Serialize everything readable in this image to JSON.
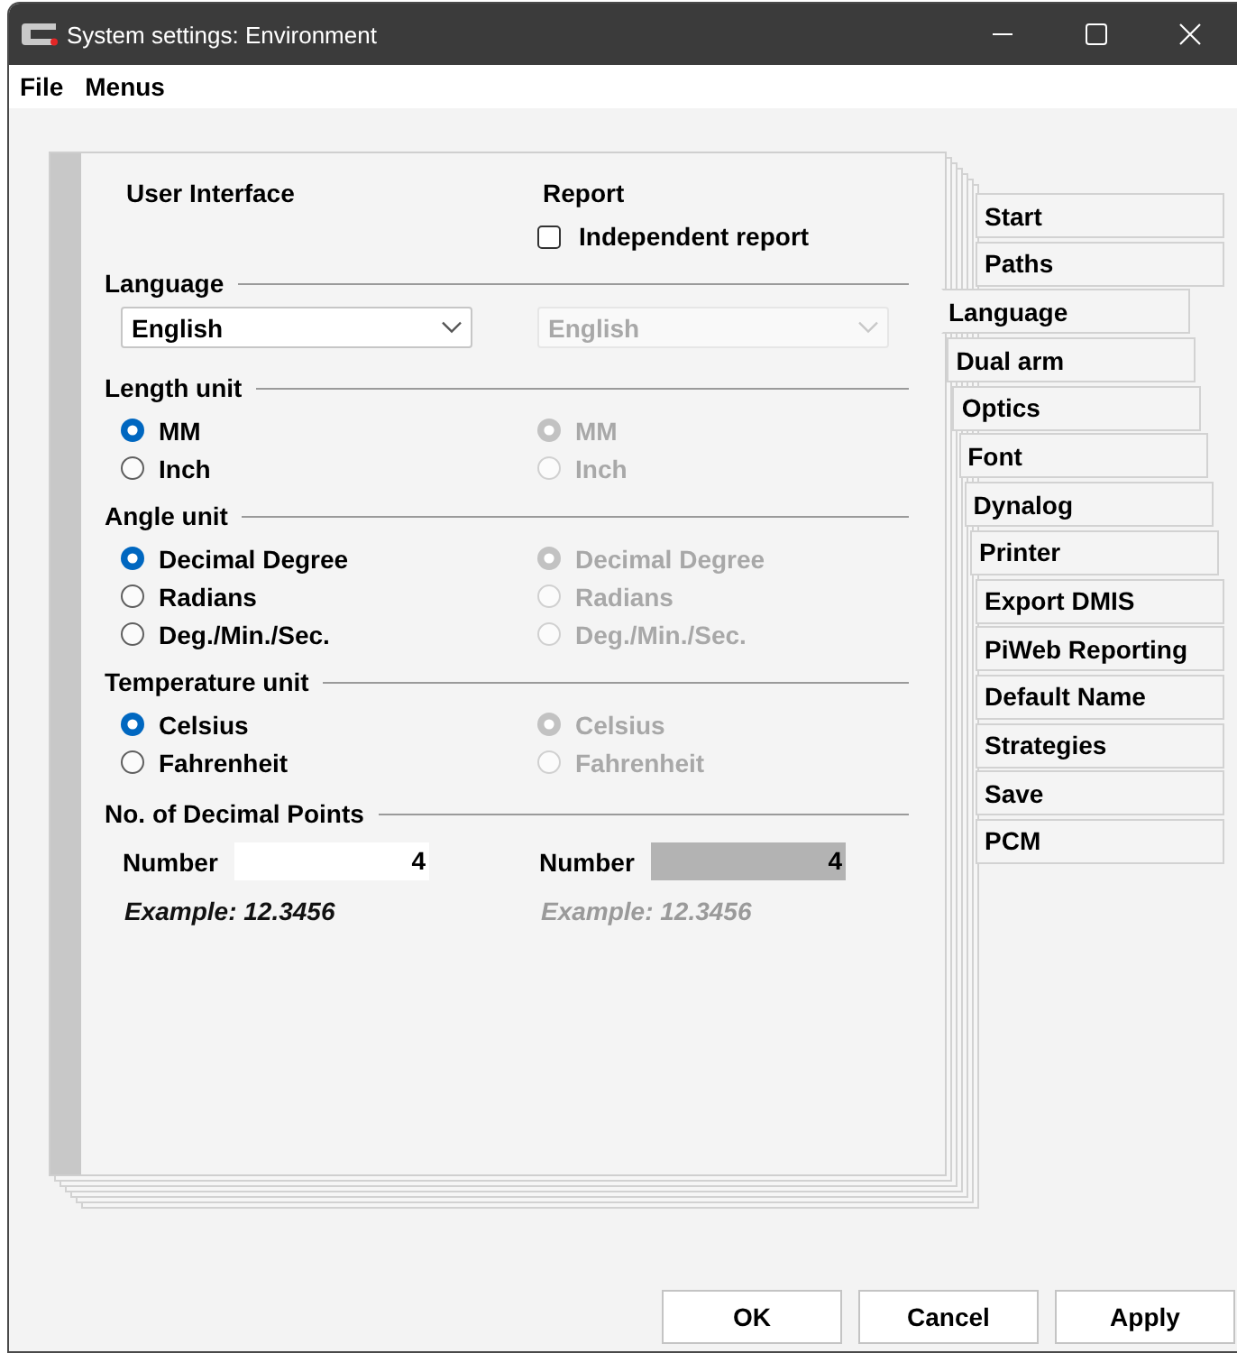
{
  "window": {
    "title": "System settings: Environment"
  },
  "menu": [
    "File",
    "Menus"
  ],
  "page": {
    "headers": [
      {
        "label": "User Interface"
      },
      {
        "label": "Report",
        "checkbox": {
          "label": "Independent report",
          "checked": false
        }
      }
    ],
    "sections": [
      {
        "kind": "dropdown",
        "title": "Language",
        "columns": [
          {
            "disabled": false,
            "value": "English"
          },
          {
            "disabled": true,
            "value": "English"
          }
        ]
      },
      {
        "kind": "radios",
        "title": "Length unit",
        "columns": [
          {
            "disabled": false,
            "options": [
              {
                "label": "MM",
                "selected": true
              },
              {
                "label": "Inch",
                "selected": false
              }
            ]
          },
          {
            "disabled": true,
            "options": [
              {
                "label": "MM",
                "selected": true
              },
              {
                "label": "Inch",
                "selected": false
              }
            ]
          }
        ]
      },
      {
        "kind": "radios",
        "title": "Angle unit",
        "columns": [
          {
            "disabled": false,
            "options": [
              {
                "label": "Decimal Degree",
                "selected": true
              },
              {
                "label": "Radians",
                "selected": false
              },
              {
                "label": "Deg./Min./Sec.",
                "selected": false
              }
            ]
          },
          {
            "disabled": true,
            "options": [
              {
                "label": "Decimal Degree",
                "selected": true
              },
              {
                "label": "Radians",
                "selected": false
              },
              {
                "label": "Deg./Min./Sec.",
                "selected": false
              }
            ]
          }
        ]
      },
      {
        "kind": "radios",
        "title": "Temperature unit",
        "columns": [
          {
            "disabled": false,
            "options": [
              {
                "label": "Celsius",
                "selected": true
              },
              {
                "label": "Fahrenheit",
                "selected": false
              }
            ]
          },
          {
            "disabled": true,
            "options": [
              {
                "label": "Celsius",
                "selected": true
              },
              {
                "label": "Fahrenheit",
                "selected": false
              }
            ]
          }
        ]
      },
      {
        "kind": "number",
        "title": "No. of Decimal Points",
        "columns": [
          {
            "disabled": false,
            "label": "Number",
            "value": "4",
            "example": "Example: 12.3456"
          },
          {
            "disabled": true,
            "label": "Number",
            "value": "4",
            "example": "Example: 12.3456"
          }
        ]
      }
    ]
  },
  "tabs": [
    {
      "label": "Start",
      "selected": false
    },
    {
      "label": "Paths",
      "selected": false
    },
    {
      "label": "Language",
      "selected": true
    },
    {
      "label": "Dual arm",
      "selected": false
    },
    {
      "label": "Optics",
      "selected": false
    },
    {
      "label": "Font",
      "selected": false
    },
    {
      "label": "Dynalog",
      "selected": false
    },
    {
      "label": "Printer",
      "selected": false
    },
    {
      "label": "Export DMIS",
      "selected": false
    },
    {
      "label": "PiWeb Reporting",
      "selected": false
    },
    {
      "label": "Default Name",
      "selected": false
    },
    {
      "label": "Strategies",
      "selected": false
    },
    {
      "label": "Save",
      "selected": false
    },
    {
      "label": "PCM",
      "selected": false
    }
  ],
  "buttons": [
    "OK",
    "Cancel",
    "Apply"
  ]
}
